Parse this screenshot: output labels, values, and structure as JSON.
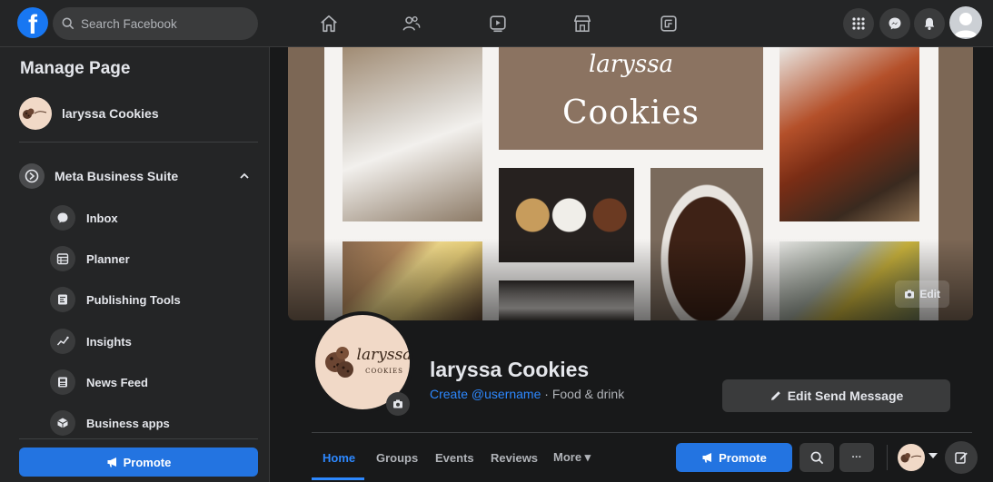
{
  "topbar": {
    "logo": "f",
    "search_placeholder": "Search Facebook",
    "nav_icons": [
      "home-icon",
      "friends-icon",
      "watch-icon",
      "marketplace-icon",
      "gaming-icon"
    ],
    "right_icons": [
      "menu-grid-icon",
      "messenger-icon",
      "notifications-icon"
    ]
  },
  "sidebar": {
    "title": "Manage Page",
    "page_name": "laryssa Cookies",
    "business_suite_label": "Meta Business Suite",
    "items": [
      {
        "label": "Inbox",
        "icon": "inbox-icon"
      },
      {
        "label": "Planner",
        "icon": "planner-icon"
      },
      {
        "label": "Publishing Tools",
        "icon": "publishing-tools-icon"
      },
      {
        "label": "Insights",
        "icon": "insights-icon"
      },
      {
        "label": "News Feed",
        "icon": "news-feed-icon"
      },
      {
        "label": "Business apps",
        "icon": "business-apps-icon"
      }
    ],
    "promote_label": "Promote"
  },
  "cover": {
    "logo_script": "laryssa",
    "logo_word": "Cookies",
    "edit_label": "Edit"
  },
  "profile": {
    "logo_script": "laryssa",
    "logo_word": "COOKIES",
    "name": "laryssa Cookies",
    "username_link": "Create @username",
    "category": " · Food & drink",
    "edit_send_label": "Edit Send Message"
  },
  "tabs": [
    {
      "label": "Home",
      "active": true
    },
    {
      "label": "Groups"
    },
    {
      "label": "Events"
    },
    {
      "label": "Reviews"
    },
    {
      "label": "More ▾"
    }
  ],
  "actions": {
    "promote_label": "Promote",
    "more_label": "···"
  },
  "colors": {
    "accent": "#2374e1",
    "link": "#2d88ff",
    "background": "#18191a",
    "surface": "#242526"
  }
}
